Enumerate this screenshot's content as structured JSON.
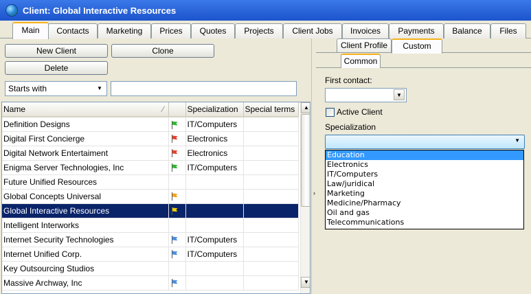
{
  "window": {
    "title": "Client: Global Interactive Resources"
  },
  "tabs": [
    {
      "label": "Main",
      "active": true
    },
    {
      "label": "Contacts"
    },
    {
      "label": "Marketing"
    },
    {
      "label": "Prices"
    },
    {
      "label": "Quotes"
    },
    {
      "label": "Projects"
    },
    {
      "label": "Client Jobs"
    },
    {
      "label": "Invoices"
    },
    {
      "label": "Payments"
    },
    {
      "label": "Balance"
    },
    {
      "label": "Files"
    }
  ],
  "toolbar": {
    "new_client": "New Client",
    "clone": "Clone",
    "delete": "Delete"
  },
  "filter": {
    "mode": "Starts with",
    "text": ""
  },
  "grid": {
    "columns": [
      "Name",
      "",
      "Specialization",
      "Special terms"
    ],
    "rows": [
      {
        "name": "Definition Designs",
        "flag": "green",
        "spec": "IT/Computers",
        "terms": ""
      },
      {
        "name": "Digital First Concierge",
        "flag": "red",
        "spec": "Electronics",
        "terms": ""
      },
      {
        "name": "Digital Network Entertaiment",
        "flag": "red",
        "spec": "Electronics",
        "terms": ""
      },
      {
        "name": "Enigma Server Technologies, Inc",
        "flag": "green",
        "spec": "IT/Computers",
        "terms": ""
      },
      {
        "name": "Future Unified Resources",
        "flag": "",
        "spec": "",
        "terms": ""
      },
      {
        "name": "Global Concepts Universal",
        "flag": "orange",
        "spec": "",
        "terms": ""
      },
      {
        "name": "Global Interactive Resources",
        "flag": "yellow",
        "spec": "",
        "terms": "",
        "selected": true
      },
      {
        "name": "Intelligent Interworks",
        "flag": "",
        "spec": "",
        "terms": ""
      },
      {
        "name": "Internet Security Technologies",
        "flag": "blue",
        "spec": "IT/Computers",
        "terms": ""
      },
      {
        "name": "Internet Unified Corp.",
        "flag": "blue",
        "spec": "IT/Computers",
        "terms": ""
      },
      {
        "name": "Key Outsourcing Studios",
        "flag": "",
        "spec": "",
        "terms": ""
      },
      {
        "name": "Massive Archway, Inc",
        "flag": "blue",
        "spec": "",
        "terms": ""
      }
    ]
  },
  "flag_colors": {
    "green": "#2eb82e",
    "red": "#e8412c",
    "orange": "#f3a21b",
    "yellow": "#f0d000",
    "blue": "#4a90e2"
  },
  "right_panel": {
    "tabs": [
      {
        "label": "Client Profile"
      },
      {
        "label": "Custom",
        "active": true
      }
    ],
    "subtabs": [
      {
        "label": "Common",
        "active": true
      }
    ],
    "first_contact_label": "First contact:",
    "first_contact_value": "",
    "active_client_label": "Active Client",
    "active_client_checked": false,
    "specialization_label": "Specialization",
    "specialization_value": "",
    "specialization_options": [
      "Education",
      "Electronics",
      "IT/Computers",
      "Law/juridical",
      "Marketing",
      "Medicine/Pharmacy",
      "Oil and gas",
      "Telecommunications"
    ],
    "highlighted_option": "Education"
  }
}
